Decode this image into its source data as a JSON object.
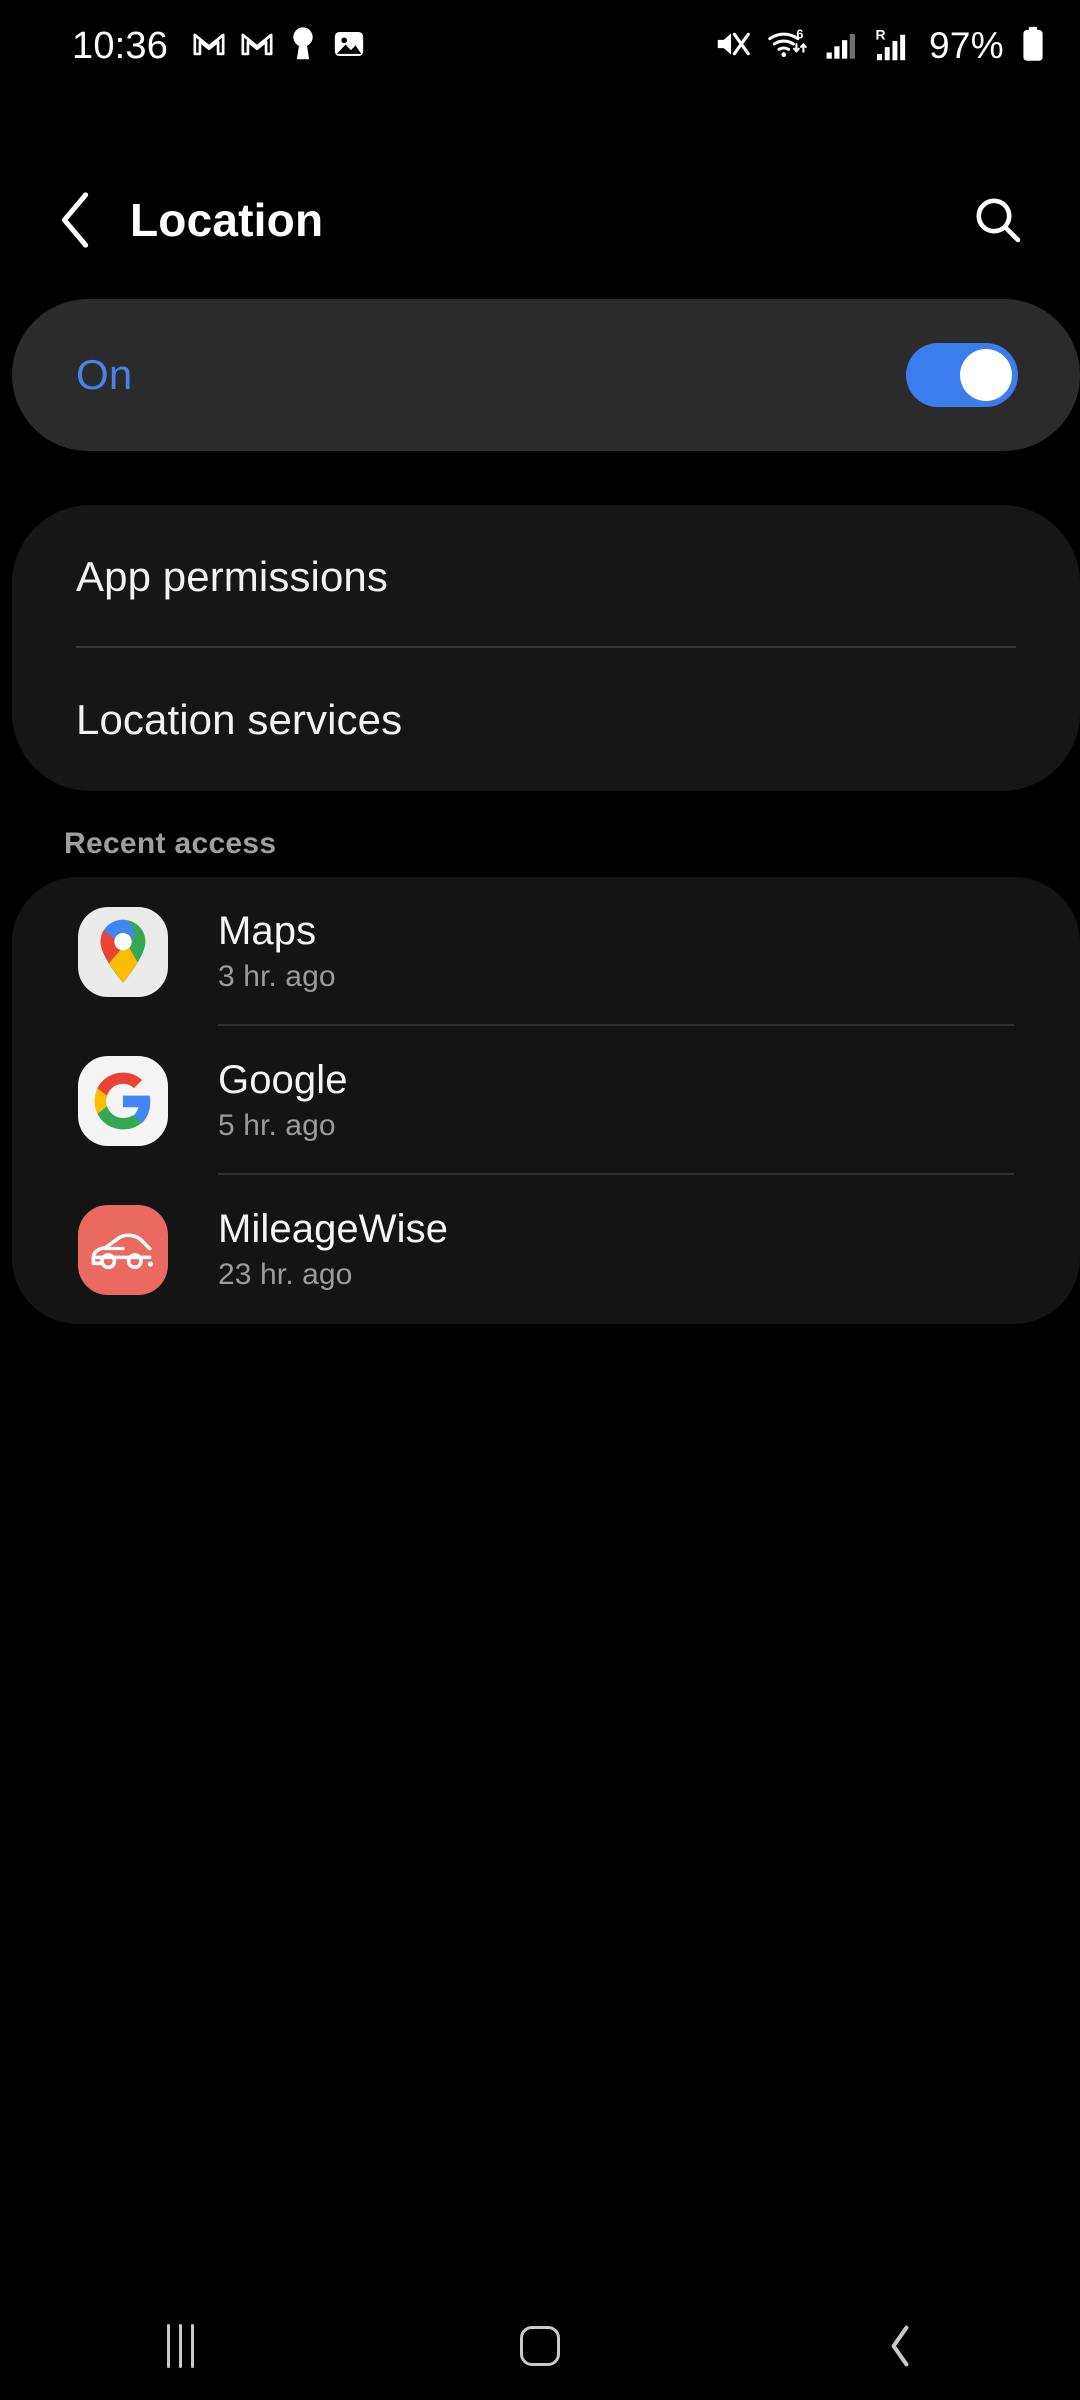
{
  "status_bar": {
    "time": "10:36",
    "left_icons": [
      "gmail-icon",
      "gmail-icon",
      "keyhole-icon",
      "photo-icon"
    ],
    "right_icons": [
      "mute-icon",
      "wifi-6-icon",
      "signal-icon",
      "roaming-signal-icon"
    ],
    "battery_percent": "97%",
    "battery_icon": "battery-full-icon"
  },
  "app_bar": {
    "back_icon": "back-chevron-icon",
    "title": "Location",
    "search_icon": "search-icon"
  },
  "location_toggle": {
    "label": "On",
    "state": "on",
    "accent_color": "#3b7dec",
    "label_color": "#4c82e8"
  },
  "menu": {
    "items": [
      {
        "label": "App permissions",
        "name": "app-permissions"
      },
      {
        "label": "Location services",
        "name": "location-services"
      }
    ]
  },
  "recent_access": {
    "header": "Recent access",
    "apps": [
      {
        "name": "Maps",
        "time": "3 hr. ago",
        "icon": "google-maps-icon",
        "icon_bg": "#ebebeb"
      },
      {
        "name": "Google",
        "time": "5 hr. ago",
        "icon": "google-g-icon",
        "icon_bg": "#f4f4f4"
      },
      {
        "name": "MileageWise",
        "time": "23 hr. ago",
        "icon": "mileagewise-car-icon",
        "icon_bg": "#ea6a62"
      }
    ]
  },
  "nav_bar": {
    "recents_label": "recents-icon",
    "home_label": "home-icon",
    "back_label": "back-icon"
  },
  "colors": {
    "background": "#000000",
    "card_toggle_bg": "#2b2b2b",
    "card_bg": "#161616",
    "card_recent_bg": "#141414",
    "divider": "#3a3a3a",
    "text_primary": "#f2f2f2",
    "text_secondary": "#9b9b9b"
  }
}
